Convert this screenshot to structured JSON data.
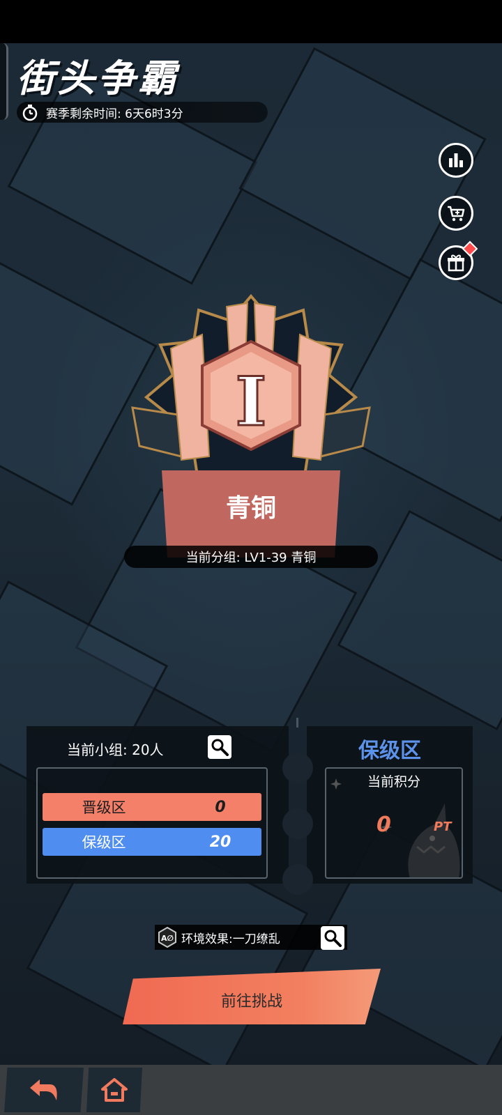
{
  "header": {
    "title": "街头争霸",
    "season_timer": "赛季剩余时间: 6天6时3分"
  },
  "side_buttons": [
    {
      "icon": "leaderboard-icon"
    },
    {
      "icon": "shop-cart-icon"
    },
    {
      "icon": "gift-icon",
      "has_badge": true
    }
  ],
  "rank": {
    "numeral": "I",
    "name": "青铜",
    "current_group": "当前分组:  LV1-39 青铜"
  },
  "group": {
    "title": "当前小组: 20人",
    "zones": [
      {
        "label": "晋级区",
        "count": "0"
      },
      {
        "label": "保级区",
        "count": "20"
      }
    ]
  },
  "score": {
    "zone_state": "保级区",
    "label": "当前积分",
    "value": "0",
    "unit": "PT"
  },
  "environment": {
    "text": "环境效果:一刀缭乱"
  },
  "challenge_button": "前往挑战",
  "colors": {
    "promote": "#f5806a",
    "keep": "#4f8ef0",
    "accent": "#f06a52"
  }
}
